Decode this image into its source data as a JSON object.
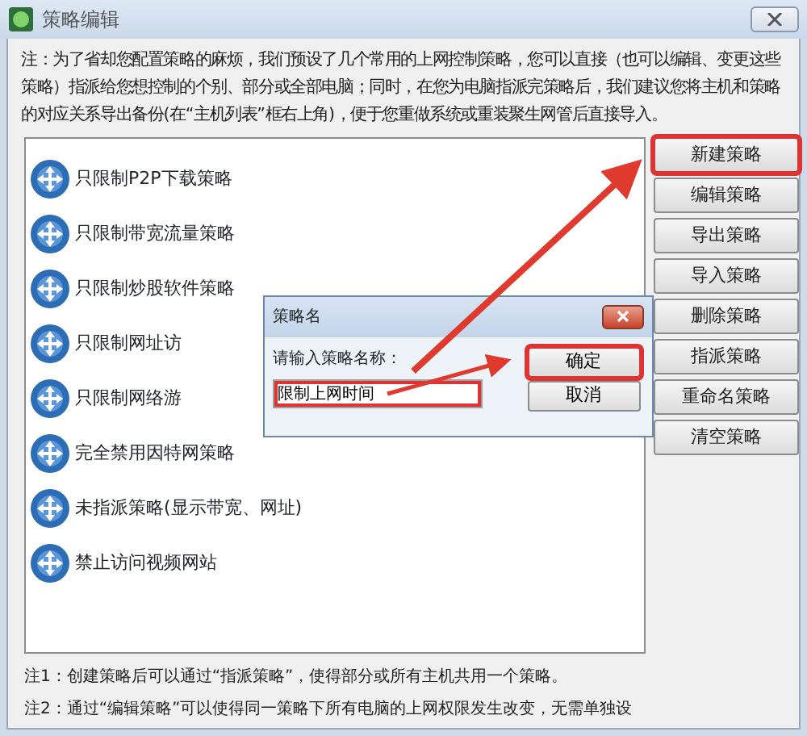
{
  "window": {
    "title": "策略编辑"
  },
  "note": "注：为了省却您配置策略的麻烦，我们预设了几个常用的上网控制策略，您可以直接（也可以编辑、变更这些策略）指派给您想控制的个别、部分或全部电脑；同时，在您为电脑指派完策略后，我们建议您将主机和策略的对应关系导出备份(在“主机列表”框右上角)，便于您重做系统或重装聚生网管后直接导入。",
  "policies": [
    {
      "label": "只限制P2P下载策略"
    },
    {
      "label": "只限制带宽流量策略"
    },
    {
      "label": "只限制炒股软件策略"
    },
    {
      "label": "只限制网址访"
    },
    {
      "label": "只限制网络游"
    },
    {
      "label": "完全禁用因特网策略"
    },
    {
      "label": "未指派策略(显示带宽、网址)"
    },
    {
      "label": "禁止访问视频网站"
    }
  ],
  "buttons": [
    {
      "label": "新建策略",
      "highlighted": true
    },
    {
      "label": "编辑策略",
      "highlighted": false
    },
    {
      "label": "导出策略",
      "highlighted": false
    },
    {
      "label": "导入策略",
      "highlighted": false
    },
    {
      "label": "删除策略",
      "highlighted": false
    },
    {
      "label": "指派策略",
      "highlighted": false
    },
    {
      "label": "重命名策略",
      "highlighted": false
    },
    {
      "label": "清空策略",
      "highlighted": false
    }
  ],
  "dialog": {
    "title": "策略名",
    "prompt": "请输入策略名称：",
    "value": "限制上网时间",
    "value_highlighted": true,
    "buttons": [
      {
        "label": "确定",
        "highlighted": true
      },
      {
        "label": "取消",
        "highlighted": false
      }
    ]
  },
  "footnotes": [
    "注1：创建策略后可以通过“指派策略”，使得部分或所有主机共用一个策略。",
    "注2：通过“编辑策略”可以使得同一策略下所有电脑的上网权限发生改变，无需单独设"
  ]
}
